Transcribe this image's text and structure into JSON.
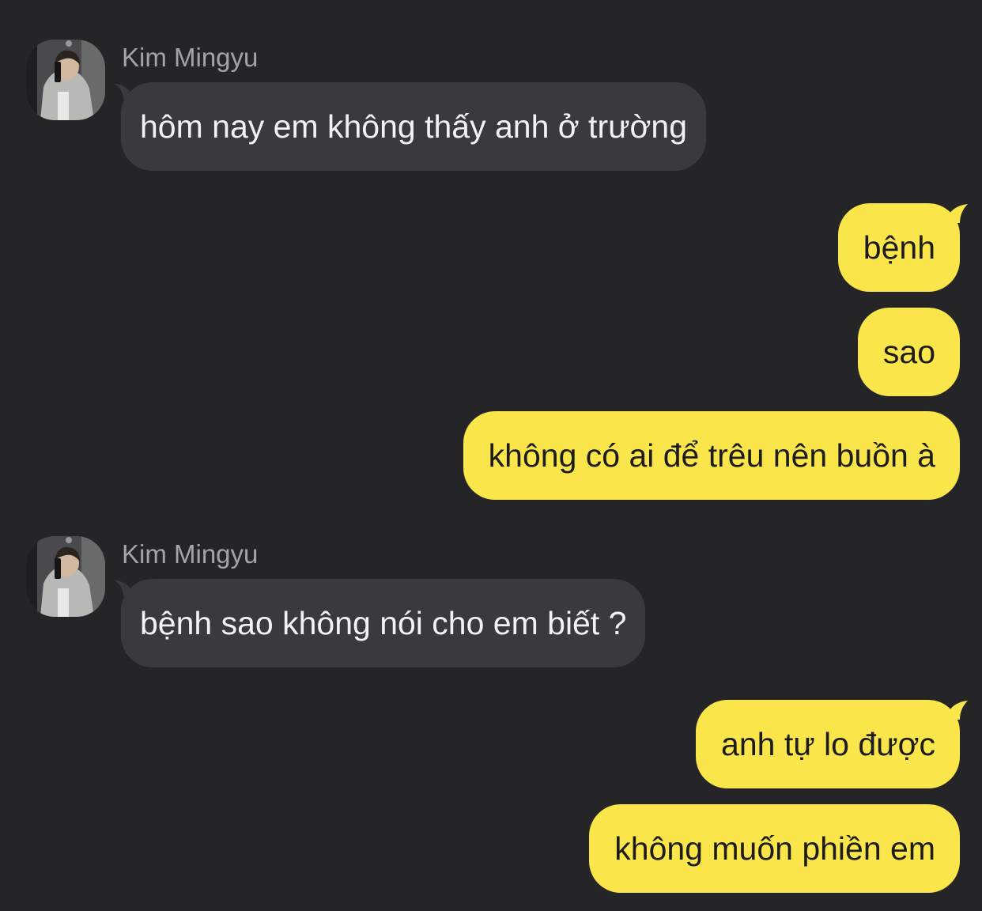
{
  "theme": {
    "background": "#252527",
    "incoming_bubble": "#3a3a3c",
    "outgoing_bubble": "#fae54b",
    "sender_name_color": "#a4a4a8"
  },
  "messages": [
    {
      "direction": "incoming",
      "sender": "Kim Mingyu",
      "avatar_icon": "profile-photo-icon",
      "text": "hôm nay em không thấy anh ở trường"
    },
    {
      "direction": "outgoing",
      "text": "bệnh"
    },
    {
      "direction": "outgoing",
      "text": "sao"
    },
    {
      "direction": "outgoing",
      "text": "không có ai để trêu nên buồn à"
    },
    {
      "direction": "incoming",
      "sender": "Kim Mingyu",
      "avatar_icon": "profile-photo-icon",
      "text": "bệnh sao không nói cho em biết ?"
    },
    {
      "direction": "outgoing",
      "text": "anh tự lo được"
    },
    {
      "direction": "outgoing",
      "text": "không muốn phiền em"
    }
  ]
}
